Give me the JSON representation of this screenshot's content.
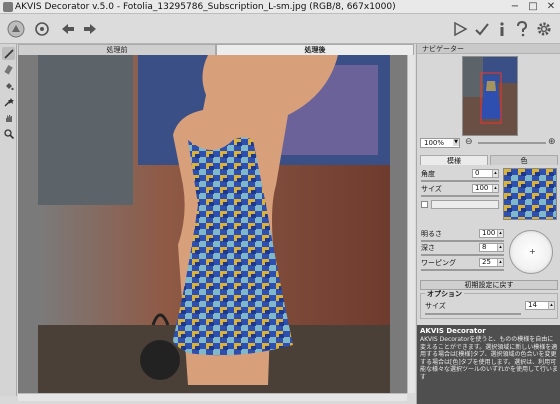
{
  "window": {
    "title": "AKVIS Decorator v.5.0 - Fotolia_13295786_Subscription_L-sm.jpg (RGB/8, 667x1000)",
    "minimize": "−",
    "maximize": "□",
    "close": "✕"
  },
  "toolbar": {
    "left_icons": [
      "open-icon",
      "undo-icon",
      "redo-icon"
    ],
    "right_icons": [
      "run-icon",
      "apply-icon",
      "info-icon",
      "help-icon",
      "settings-icon"
    ]
  },
  "left_tools": [
    "brush-icon",
    "eraser-icon",
    "fill-icon",
    "magic-wand-icon",
    "hand-icon",
    "zoom-icon"
  ],
  "view_tabs": {
    "before": "処理前",
    "after": "処理後"
  },
  "navigator": {
    "header": "ナビゲーター",
    "zoom": "100%"
  },
  "settings": {
    "tab_pattern": "模様",
    "tab_color": "色",
    "angle_label": "角度",
    "angle_value": "0",
    "size_label": "サイズ",
    "size_value": "100",
    "brightness_label": "明るさ",
    "brightness_value": "100",
    "depth_label": "深さ",
    "depth_value": "8",
    "warping_label": "ワーピング",
    "warping_value": "25",
    "reset_button": "初期設定に戻す",
    "options_group": "オプション",
    "options_size_label": "サイズ",
    "options_size_value": "14"
  },
  "hint": {
    "title": "AKVIS Decorator",
    "body": "AKVIS Decoratorを使うと、ものの模様を自由に変えることができます。選択領域に新しい模様を適用する場合は[模様]タブ、選択領域の色合いを変更する場合は[色]タブを使用します。選択は、利用可能な様々な選択ツールのいずれかを使用して行います"
  },
  "colors": {
    "dress_blue": "#2f4fb0",
    "dress_yellow": "#d9b23a",
    "dress_cyan": "#7fb8c8",
    "brick": "#8a4a36",
    "hint_bg": "#4f4f4f"
  }
}
